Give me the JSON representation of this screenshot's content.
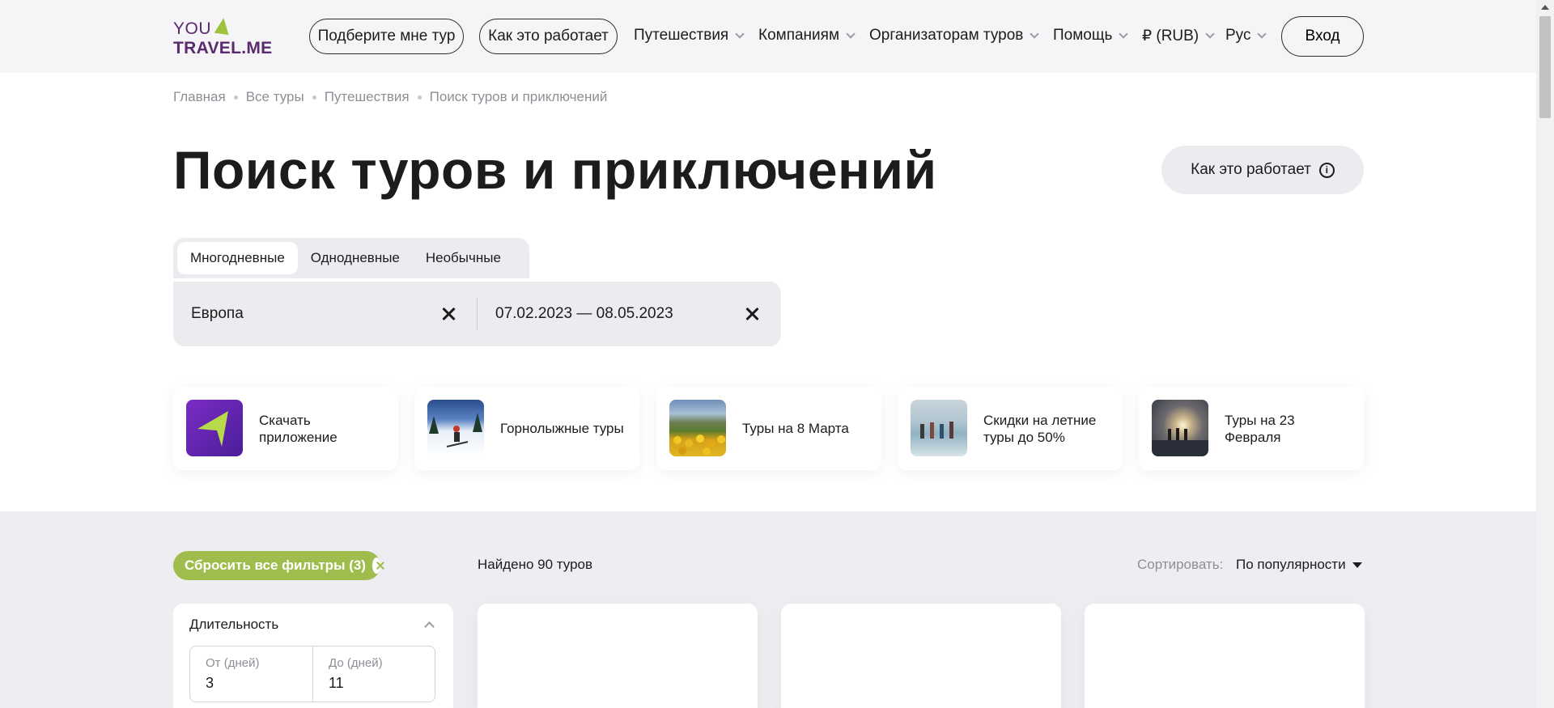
{
  "header": {
    "logo_top": "YOU",
    "logo_bottom": "TRAVEL.ME",
    "pick_tour": "Подберите мне тур",
    "how_it_works": "Как это работает",
    "nav": [
      {
        "label": "Путешествия"
      },
      {
        "label": "Компаниям"
      },
      {
        "label": "Организаторам туров"
      },
      {
        "label": "Помощь"
      },
      {
        "label": "₽ (RUB)"
      },
      {
        "label": "Рус"
      }
    ],
    "login": "Вход"
  },
  "breadcrumb": [
    "Главная",
    "Все туры",
    "Путешествия",
    "Поиск туров и приключений"
  ],
  "page_title": "Поиск туров и приключений",
  "how_button": "Как это работает",
  "tabs": [
    {
      "label": "Многодневные",
      "active": true
    },
    {
      "label": "Однодневные",
      "active": false
    },
    {
      "label": "Необычные",
      "active": false
    }
  ],
  "search": {
    "destination": "Европа",
    "dates": "07.02.2023 — 08.05.2023"
  },
  "promos": [
    {
      "label": "Скачать приложение",
      "icon": "app-icon"
    },
    {
      "label": "Горнолыжные туры",
      "icon": "ski-photo"
    },
    {
      "label": "Туры на 8 Марта",
      "icon": "tulips-photo"
    },
    {
      "label": "Скидки на летние туры до 50%",
      "icon": "beach-photo"
    },
    {
      "label": "Туры на 23 Февраля",
      "icon": "sunset-photo"
    }
  ],
  "results": {
    "reset_filters": "Сбросить все фильтры (3)",
    "found": "Найдено 90 туров",
    "sort_label": "Сортировать:",
    "sort_value": "По популярности"
  },
  "filter": {
    "title": "Длительность",
    "from_label": "От (дней)",
    "from_value": "3",
    "to_label": "До (дней)",
    "to_value": "11"
  },
  "colors": {
    "brand_purple": "#5a2a6e",
    "brand_green": "#9fbd4c",
    "header_bg": "#f5f5f7",
    "section_bg": "#eeeef2"
  }
}
